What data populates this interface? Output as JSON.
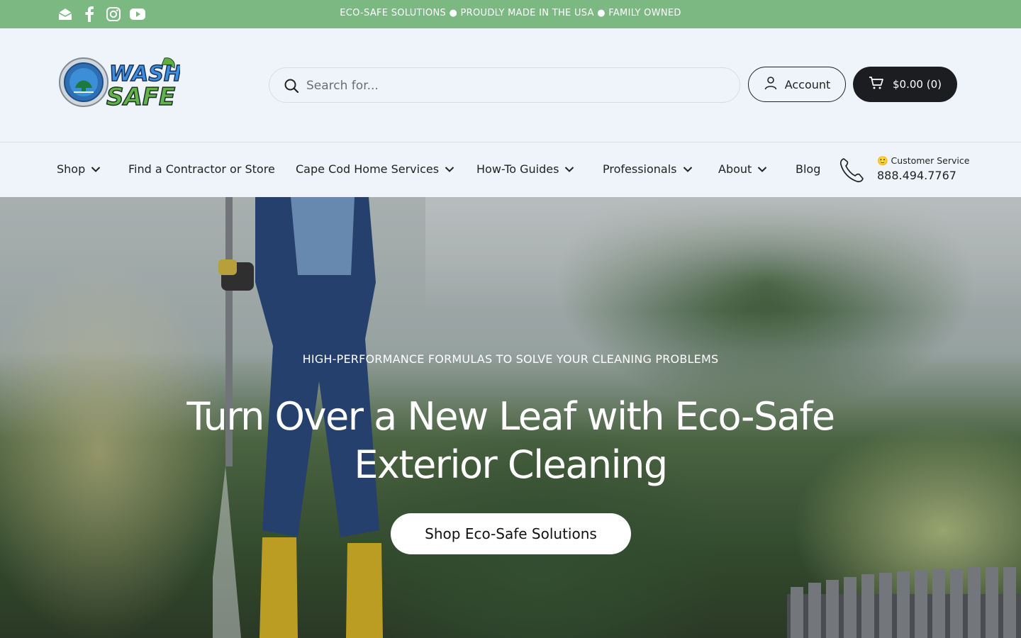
{
  "announcement": {
    "text": "ECO-SAFE SOLUTIONS ● PROUDLY MADE IN THE USA ● FAMILY OWNED",
    "social_icons": [
      "email-icon",
      "facebook-icon",
      "instagram-icon",
      "youtube-icon"
    ],
    "background_color": "#7cb982"
  },
  "header": {
    "logo_text_top": "WASH",
    "logo_text_bottom": "SAFE",
    "search_placeholder": "Search for...",
    "account_label": "Account",
    "cart_label": "$0.00 (0)"
  },
  "nav": {
    "items": [
      {
        "label": "Shop",
        "has_dropdown": true
      },
      {
        "label": "Find a Contractor or Store",
        "has_dropdown": false
      },
      {
        "label": "Cape Cod Home Services",
        "has_dropdown": true
      },
      {
        "label": "How-To Guides",
        "has_dropdown": true
      },
      {
        "label": "Professionals",
        "has_dropdown": true
      },
      {
        "label": "About",
        "has_dropdown": true
      },
      {
        "label": "Blog",
        "has_dropdown": false
      }
    ],
    "customer_service_label": "🙂 Customer Service",
    "phone": "888.494.7767"
  },
  "hero": {
    "subheading": "HIGH-PERFORMANCE FORMULAS TO SOLVE YOUR CLEANING PROBLEMS",
    "title": "Turn Over a New Leaf with Eco-Safe Exterior Cleaning",
    "cta_label": "Shop Eco-Safe Solutions"
  }
}
